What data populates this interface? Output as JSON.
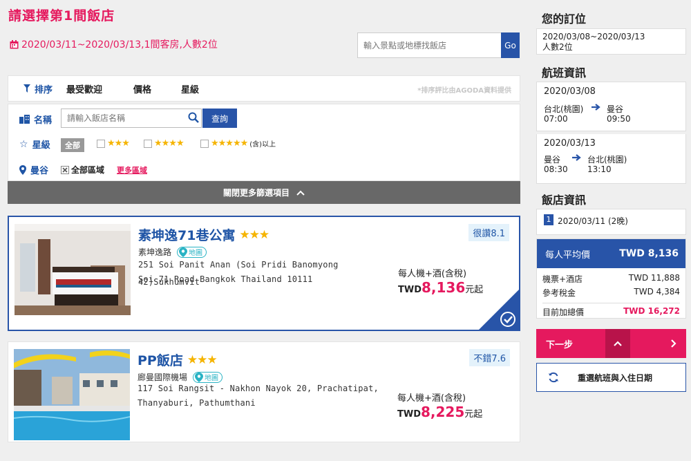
{
  "header": {
    "title": "請選擇第1間飯店",
    "summary": "2020/03/11~2020/03/13,1間客房,人數2位",
    "search_placeholder": "輸入景點或地標找飯店",
    "search_button": "Go"
  },
  "sort": {
    "label": "排序",
    "options": [
      "最受歡迎",
      "價格",
      "星級"
    ],
    "note": "*排序評比由AGODA資料提供"
  },
  "filters": {
    "name_label": "名稱",
    "name_placeholder": "請輸入飯店名稱",
    "name_button": "查詢",
    "star_label": "星級",
    "star_all": "全部",
    "star_suffix": "(含)以上",
    "star_options": [
      "★★★",
      "★★★★",
      "★★★★★"
    ],
    "area_label": "曼谷",
    "area_all": "全部區域",
    "area_more": "更多區域",
    "collapse_label": "關閉更多篩選項目"
  },
  "hotels": [
    {
      "name": "素坤逸71巷公寓",
      "stars": "★★★",
      "area": "素坤逸路",
      "map_label": "地圖",
      "address_line1": "251 Soi Panit Anan (Soi Pridi Banomyong 42)Sukhumvit",
      "address_line2": "Soi 71 Road Bangkok Thailand 10111",
      "rating": "很讚8.1",
      "price_label": "每人機+酒(含稅)",
      "currency": "TWD",
      "price": "8,136",
      "price_suffix": "元起"
    },
    {
      "name": "PP飯店",
      "stars": "★★★",
      "area": "廊曼國際機場",
      "map_label": "地圖",
      "address_line1": "117 Soi Rangsit - Nakhon Nayok 20, Prachatipat,",
      "address_line2": "Thanyaburi, Pathumthani",
      "rating": "不錯7.6",
      "price_label": "每人機+酒(含稅)",
      "currency": "TWD",
      "price": "8,225",
      "price_suffix": "元起"
    }
  ],
  "sidebar": {
    "booking_title": "您的訂位",
    "booking_dates": "2020/03/08~2020/03/13",
    "booking_people": "人數2位",
    "flight_title": "航班資訊",
    "flights": [
      {
        "date": "2020/03/08",
        "from": "台北(桃園)",
        "to": "曼谷",
        "dep": "07:00",
        "arr": "09:50"
      },
      {
        "date": "2020/03/13",
        "from": "曼谷",
        "to": "台北(桃園)",
        "dep": "08:30",
        "arr": "13:10"
      }
    ],
    "hotel_title": "飯店資訊",
    "hotel_index": "1",
    "hotel_dates": "2020/03/11 (2晚)",
    "avg_label": "每人平均價",
    "avg_value": "TWD 8,136",
    "cost_rows": [
      {
        "label": "機票+酒店",
        "value": "TWD 11,888"
      },
      {
        "label": "參考稅金",
        "value": "TWD 4,384"
      },
      {
        "label": "目前加總價",
        "value": "TWD 16,272"
      }
    ],
    "next_label": "下一步",
    "rechoose_label": "重選航班與入住日期"
  },
  "colors": {
    "brand_pink": "#e5195e",
    "brand_blue": "#2854a8",
    "star": "#f5b400"
  }
}
